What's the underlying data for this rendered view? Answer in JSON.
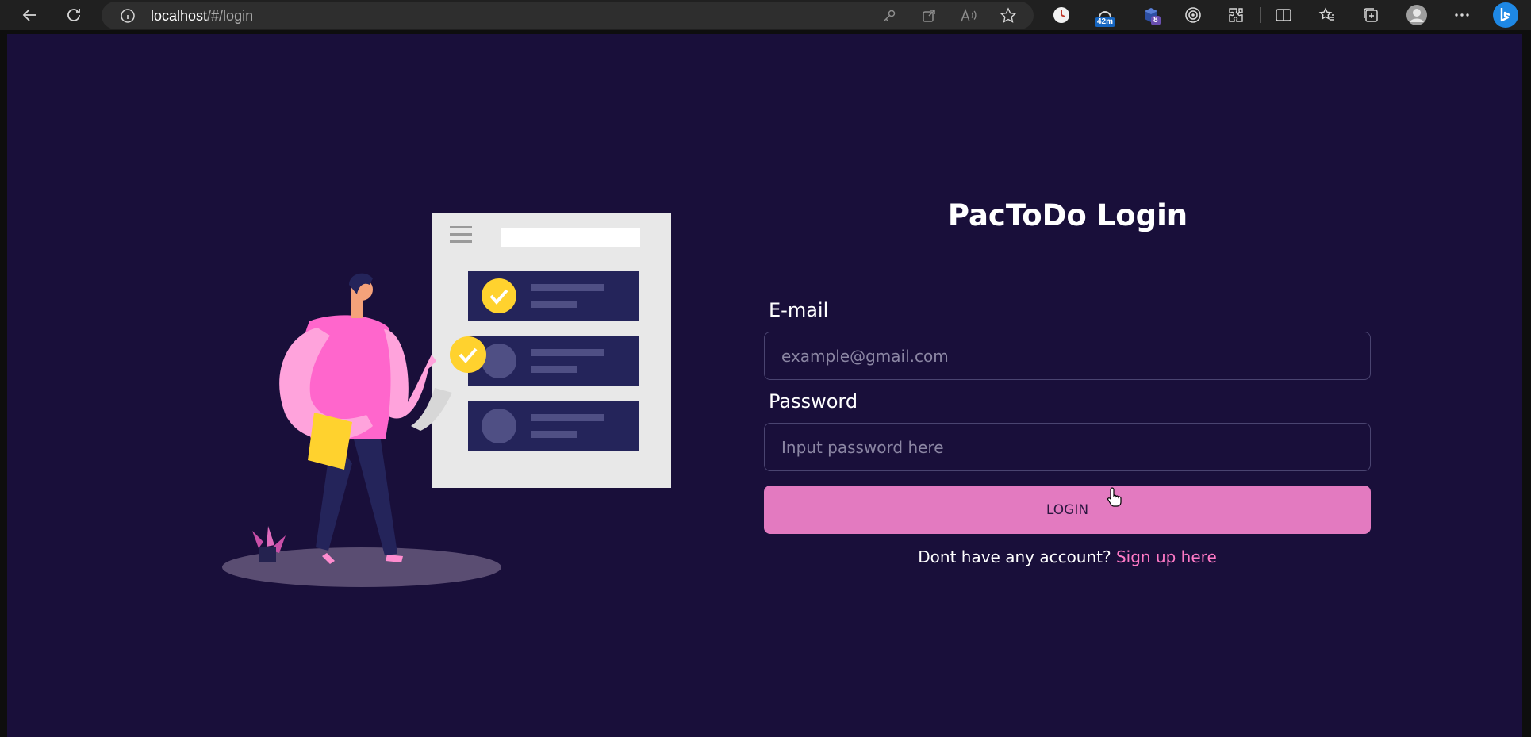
{
  "browser": {
    "url_host": "localhost",
    "url_path": "/#/login",
    "extension_badges": {
      "timer": "42m",
      "count": "8"
    },
    "icons": [
      "back-icon",
      "refresh-icon",
      "info-icon",
      "key-icon",
      "open-in-app-icon",
      "read-aloud-icon",
      "favorite-star-icon",
      "extension-clock-icon",
      "extension-timer-icon",
      "extension-cube-icon",
      "extension-target-icon",
      "extensions-puzzle-icon",
      "split-screen-icon",
      "favorites-icon",
      "collections-icon",
      "profile-icon",
      "more-icon",
      "bing-icon"
    ]
  },
  "login": {
    "title": "PacToDo Login",
    "email_label": "E-mail",
    "email_placeholder": "example@gmail.com",
    "email_value": "",
    "password_label": "Password",
    "password_placeholder": "Input password here",
    "password_value": "",
    "login_button": "LOGIN",
    "signup_prompt": "Dont have any account? ",
    "signup_link": "Sign up here"
  },
  "colors": {
    "page_bg": "#190f3a",
    "accent_button": "#e37ac0",
    "link": "#ff79c6",
    "input_border": "#4a4470"
  }
}
